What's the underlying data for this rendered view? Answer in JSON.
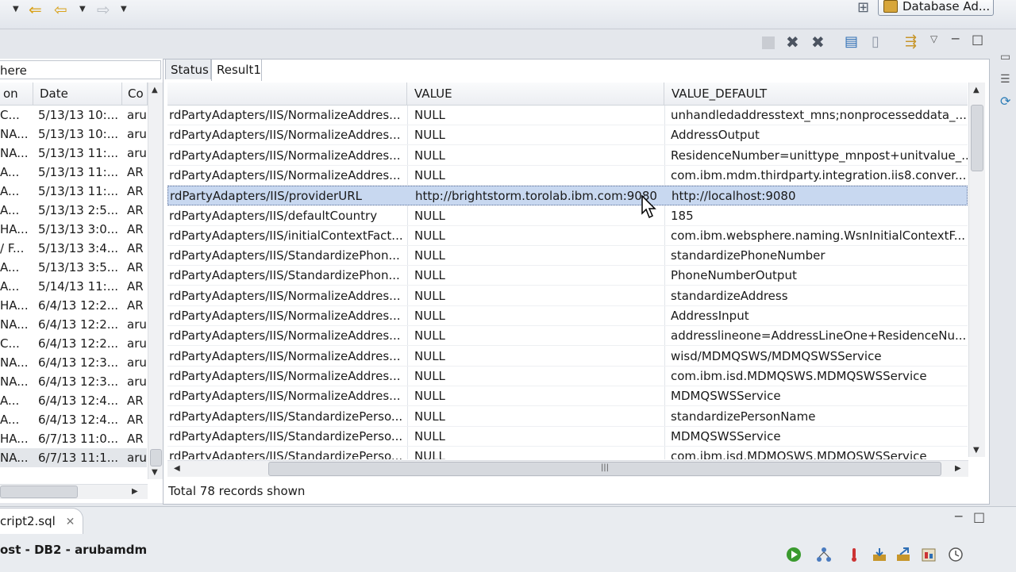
{
  "toolbar": {
    "perspective_label": "Database Ad...",
    "icons": [
      "back-arrow-icon",
      "forward-arrow-icon",
      "grid-layout-icon"
    ]
  },
  "left_panel": {
    "filter_text": "here",
    "columns": [
      "on",
      "Date",
      "Co"
    ],
    "rows": [
      [
        "C...",
        "5/13/13 10:...",
        "aru"
      ],
      [
        "NA...",
        "5/13/13 10:...",
        "aru"
      ],
      [
        "NA...",
        "5/13/13 11:...",
        "aru"
      ],
      [
        "A...",
        "5/13/13 11:...",
        "AR"
      ],
      [
        "A...",
        "5/13/13 11:...",
        "AR"
      ],
      [
        "A...",
        "5/13/13 2:5...",
        "AR"
      ],
      [
        "HA...",
        "5/13/13 3:0...",
        "AR"
      ],
      [
        "/ F...",
        "5/13/13 3:4...",
        "AR"
      ],
      [
        "A...",
        "5/13/13 3:5...",
        "AR"
      ],
      [
        "A...",
        "5/14/13 11:...",
        "AR"
      ],
      [
        "HA...",
        "6/4/13 12:2...",
        "AR"
      ],
      [
        "NA...",
        "6/4/13 12:2...",
        "aru"
      ],
      [
        "C...",
        "6/4/13 12:2...",
        "aru"
      ],
      [
        "NA...",
        "6/4/13 12:3...",
        "aru"
      ],
      [
        "NA...",
        "6/4/13 12:3...",
        "aru"
      ],
      [
        "A...",
        "6/4/13 12:4...",
        "AR"
      ],
      [
        "A...",
        "6/4/13 12:4...",
        "AR"
      ],
      [
        "HA...",
        "6/7/13 11:0...",
        "AR"
      ],
      [
        "NA...",
        "6/7/13 11:1...",
        "aru"
      ]
    ]
  },
  "tabs": [
    {
      "label": "Status"
    },
    {
      "label": "Result1"
    }
  ],
  "grid": {
    "columns": [
      "",
      "VALUE",
      "VALUE_DEFAULT"
    ],
    "rows": [
      [
        "rdPartyAdapters/IIS/NormalizeAddres...",
        "NULL",
        "unhandledaddresstext_mns;nonprocesseddata_..."
      ],
      [
        "rdPartyAdapters/IIS/NormalizeAddres...",
        "NULL",
        "AddressOutput"
      ],
      [
        "rdPartyAdapters/IIS/NormalizeAddres...",
        "NULL",
        "ResidenceNumber=unittype_mnpost+unitvalue_..."
      ],
      [
        "rdPartyAdapters/IIS/NormalizeAddres...",
        "NULL",
        "com.ibm.mdm.thirdparty.integration.iis8.conver..."
      ],
      [
        "rdPartyAdapters/IIS/providerURL",
        "http://brightstorm.torolab.ibm.com:9080",
        "http://localhost:9080"
      ],
      [
        "rdPartyAdapters/IIS/defaultCountry",
        "NULL",
        "185"
      ],
      [
        "rdPartyAdapters/IIS/initialContextFact...",
        "NULL",
        "com.ibm.websphere.naming.WsnInitialContextF..."
      ],
      [
        "rdPartyAdapters/IIS/StandardizePhon...",
        "NULL",
        "standardizePhoneNumber"
      ],
      [
        "rdPartyAdapters/IIS/StandardizePhon...",
        "NULL",
        "PhoneNumberOutput"
      ],
      [
        "rdPartyAdapters/IIS/NormalizeAddres...",
        "NULL",
        "standardizeAddress"
      ],
      [
        "rdPartyAdapters/IIS/NormalizeAddres...",
        "NULL",
        "AddressInput"
      ],
      [
        "rdPartyAdapters/IIS/NormalizeAddres...",
        "NULL",
        "addresslineone=AddressLineOne+ResidenceNu..."
      ],
      [
        "rdPartyAdapters/IIS/NormalizeAddres...",
        "NULL",
        "wisd/MDMQSWS/MDMQSWSService"
      ],
      [
        "rdPartyAdapters/IIS/NormalizeAddres...",
        "NULL",
        "com.ibm.isd.MDMQSWS.MDMQSWSService"
      ],
      [
        "rdPartyAdapters/IIS/NormalizeAddres...",
        "NULL",
        "MDMQSWSService"
      ],
      [
        "rdPartyAdapters/IIS/StandardizePerso...",
        "NULL",
        "standardizePersonName"
      ],
      [
        "rdPartyAdapters/IIS/StandardizePerso...",
        "NULL",
        "MDMQSWSService"
      ],
      [
        "rdPartyAdapters/IIS/StandardizePerso...",
        "NULL",
        "com.ibm.isd.MDMQSWS.MDMQSWSService"
      ]
    ],
    "selected_row": 4
  },
  "status": {
    "text": "Total 78 records shown"
  },
  "bottom": {
    "script_tab_label": "cript2.sql",
    "connection_text": "ost - DB2 - arubamdm"
  }
}
